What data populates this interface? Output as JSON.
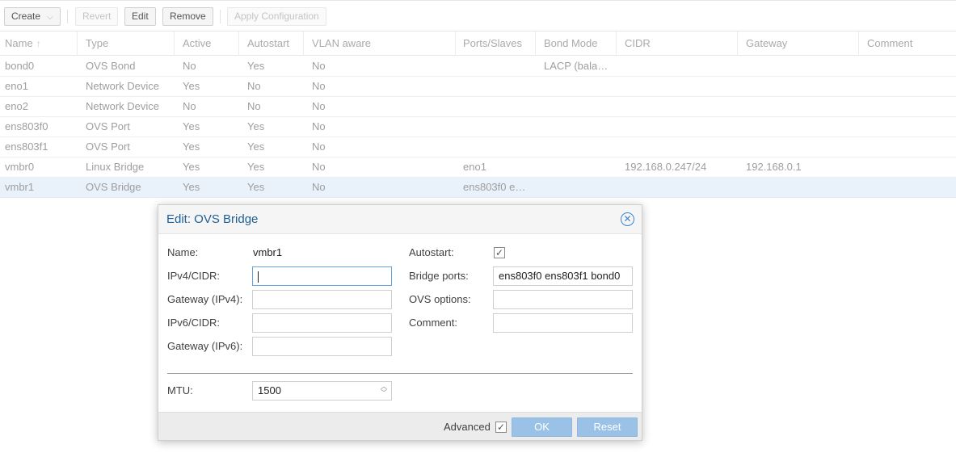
{
  "toolbar": {
    "create": "Create",
    "revert": "Revert",
    "edit": "Edit",
    "remove": "Remove",
    "apply": "Apply Configuration"
  },
  "columns": [
    "Name",
    "Type",
    "Active",
    "Autostart",
    "VLAN aware",
    "Ports/Slaves",
    "Bond Mode",
    "CIDR",
    "Gateway",
    "Comment"
  ],
  "sort_indicator": "↑",
  "rows": [
    {
      "name": "bond0",
      "type": "OVS Bond",
      "active": "No",
      "autostart": "Yes",
      "vlan": "No",
      "ports": "",
      "bond_mode": "LACP (bala…",
      "cidr": "",
      "gateway": "",
      "comment": ""
    },
    {
      "name": "eno1",
      "type": "Network Device",
      "active": "Yes",
      "autostart": "No",
      "vlan": "No",
      "ports": "",
      "bond_mode": "",
      "cidr": "",
      "gateway": "",
      "comment": ""
    },
    {
      "name": "eno2",
      "type": "Network Device",
      "active": "No",
      "autostart": "No",
      "vlan": "No",
      "ports": "",
      "bond_mode": "",
      "cidr": "",
      "gateway": "",
      "comment": ""
    },
    {
      "name": "ens803f0",
      "type": "OVS Port",
      "active": "Yes",
      "autostart": "Yes",
      "vlan": "No",
      "ports": "",
      "bond_mode": "",
      "cidr": "",
      "gateway": "",
      "comment": ""
    },
    {
      "name": "ens803f1",
      "type": "OVS Port",
      "active": "Yes",
      "autostart": "Yes",
      "vlan": "No",
      "ports": "",
      "bond_mode": "",
      "cidr": "",
      "gateway": "",
      "comment": ""
    },
    {
      "name": "vmbr0",
      "type": "Linux Bridge",
      "active": "Yes",
      "autostart": "Yes",
      "vlan": "No",
      "ports": "eno1",
      "bond_mode": "",
      "cidr": "192.168.0.247/24",
      "gateway": "192.168.0.1",
      "comment": ""
    },
    {
      "name": "vmbr1",
      "type": "OVS Bridge",
      "active": "Yes",
      "autostart": "Yes",
      "vlan": "No",
      "ports": "ens803f0 e…",
      "bond_mode": "",
      "cidr": "",
      "gateway": "",
      "comment": ""
    }
  ],
  "selected_row": "vmbr1",
  "dialog": {
    "title": "Edit: OVS Bridge",
    "name_label": "Name:",
    "name_value": "vmbr1",
    "ipv4_label": "IPv4/CIDR:",
    "ipv4_value": "",
    "gw4_label": "Gateway (IPv4):",
    "gw4_value": "",
    "ipv6_label": "IPv6/CIDR:",
    "ipv6_value": "",
    "gw6_label": "Gateway (IPv6):",
    "gw6_value": "",
    "autostart_label": "Autostart:",
    "autostart_checked": true,
    "bridge_ports_label": "Bridge ports:",
    "bridge_ports_value": "ens803f0 ens803f1 bond0",
    "ovs_options_label": "OVS options:",
    "ovs_options_value": "",
    "comment_label": "Comment:",
    "comment_value": "",
    "mtu_label": "MTU:",
    "mtu_value": "1500",
    "advanced_label": "Advanced",
    "advanced_checked": true,
    "ok_label": "OK",
    "reset_label": "Reset"
  },
  "colors": {
    "accent": "#3a84c6",
    "title": "#1f5f94",
    "selected_row": "#e9f1fa",
    "primary_button": "#9ac2e6"
  },
  "icons": {
    "close": "close-circle-icon",
    "check": "check-icon",
    "spinner": "spinner-arrows-icon",
    "dropdown": "chevron-down-icon"
  }
}
